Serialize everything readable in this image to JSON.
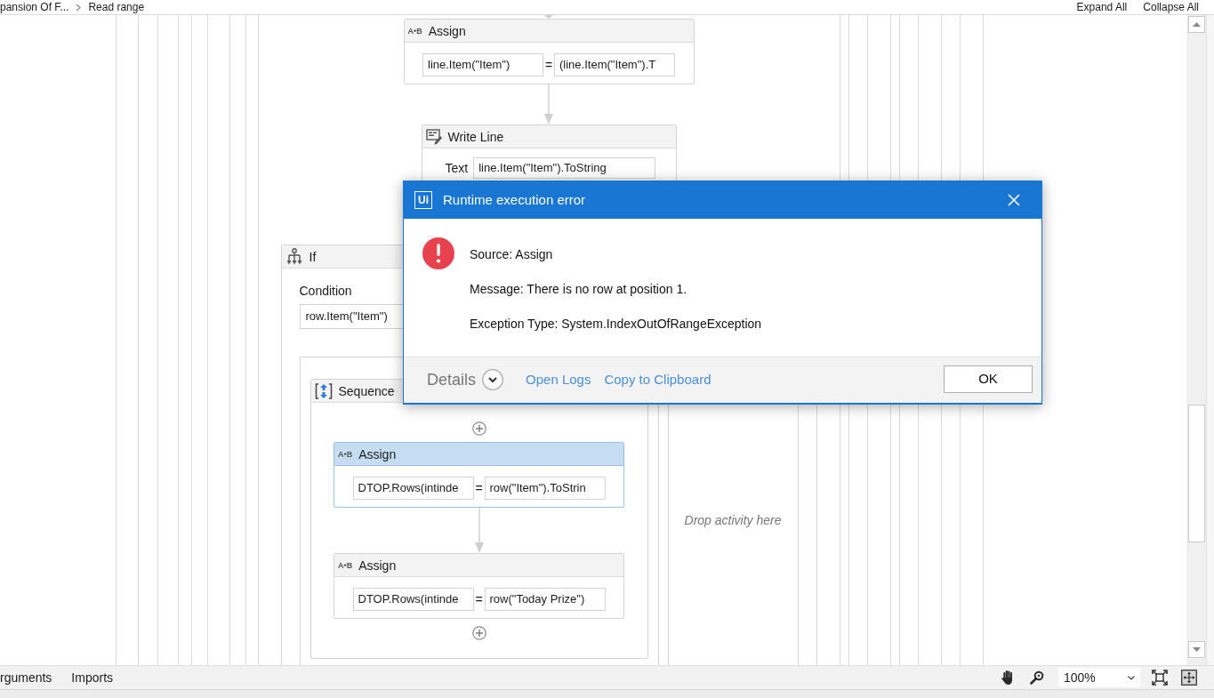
{
  "breadcrumb": {
    "items": [
      "pansion Of F...",
      "Read range"
    ],
    "actions": [
      "Expand All",
      "Collapse All"
    ]
  },
  "designer": {
    "activities": [
      {
        "kind": "assign",
        "title": "Assign",
        "icon_text": "A•B",
        "selected": false,
        "to": "line.Item(\"Item\")",
        "operator": "=",
        "value": "(line.Item(\"Item\").T"
      },
      {
        "kind": "write_line",
        "title": "Write Line",
        "selected": false,
        "label": "Text",
        "value": "line.Item(\"Item\").ToString"
      },
      {
        "kind": "if",
        "title": "If",
        "selected": false,
        "condition_label": "Condition",
        "condition": "row.Item(\"Item\")",
        "then": {
          "kind": "sequence",
          "title": "Sequence",
          "selected": false,
          "activities": [
            {
              "kind": "assign",
              "title": "Assign",
              "icon_text": "A•B",
              "selected": true,
              "to": "DTOP.Rows(intinde",
              "operator": "=",
              "value": "row(\"Item\").ToStrin"
            },
            {
              "kind": "assign",
              "title": "Assign",
              "icon_text": "A•B",
              "selected": false,
              "to": "DTOP.Rows(intinde",
              "operator": "=",
              "value": "row(\"Today Prize\")"
            }
          ]
        },
        "else": {
          "hint": "Drop activity here"
        }
      }
    ]
  },
  "dialog": {
    "logo": "Ui",
    "title": "Runtime execution error",
    "lines": [
      "Source: Assign",
      "Message: There is no row at position 1.",
      "Exception Type: System.IndexOutOfRangeException"
    ],
    "details": {
      "label": "Details",
      "expanded": false
    },
    "links": [
      "Open Logs",
      "Copy to Clipboard"
    ],
    "button": "OK"
  },
  "bottom_bar": {
    "tabs": [
      "rguments",
      "Imports"
    ],
    "zoom": "100%"
  }
}
